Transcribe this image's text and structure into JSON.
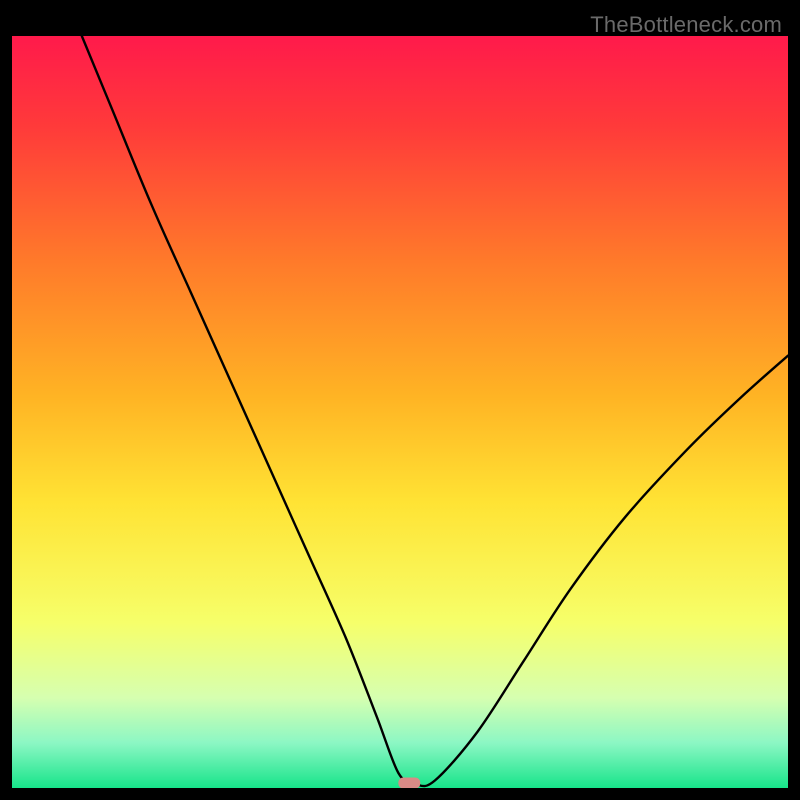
{
  "watermark": "TheBottleneck.com",
  "chart_data": {
    "type": "line",
    "title": "",
    "xlabel": "",
    "ylabel": "",
    "description": "Bottleneck curve: a single black line plotted over a vertical green-to-red gradient background. The curve starts very high on the left, drops steeply to near-zero around x≈0.51 where a small red marker sits, then rises again toward the right edge. No numeric axes are shown.",
    "xlim": [
      0,
      1
    ],
    "ylim": [
      0,
      1
    ],
    "gradient_stops": [
      {
        "offset": 0.0,
        "color": "#ff1a4b"
      },
      {
        "offset": 0.12,
        "color": "#ff3a3a"
      },
      {
        "offset": 0.3,
        "color": "#ff7a2a"
      },
      {
        "offset": 0.48,
        "color": "#ffb424"
      },
      {
        "offset": 0.62,
        "color": "#ffe334"
      },
      {
        "offset": 0.78,
        "color": "#f6ff6a"
      },
      {
        "offset": 0.88,
        "color": "#d6ffb0"
      },
      {
        "offset": 0.94,
        "color": "#8cf7c4"
      },
      {
        "offset": 1.0,
        "color": "#17e48a"
      }
    ],
    "series": [
      {
        "name": "bottleneck-curve",
        "x": [
          0.09,
          0.13,
          0.18,
          0.23,
          0.28,
          0.33,
          0.38,
          0.43,
          0.47,
          0.498,
          0.52,
          0.545,
          0.6,
          0.66,
          0.72,
          0.79,
          0.87,
          0.94,
          1.0
        ],
        "y": [
          1.0,
          0.9,
          0.775,
          0.66,
          0.545,
          0.43,
          0.315,
          0.2,
          0.095,
          0.02,
          0.005,
          0.01,
          0.075,
          0.17,
          0.265,
          0.36,
          0.45,
          0.52,
          0.575
        ]
      }
    ],
    "marker": {
      "x": 0.512,
      "y": 0.006,
      "color": "#d88a86"
    }
  }
}
